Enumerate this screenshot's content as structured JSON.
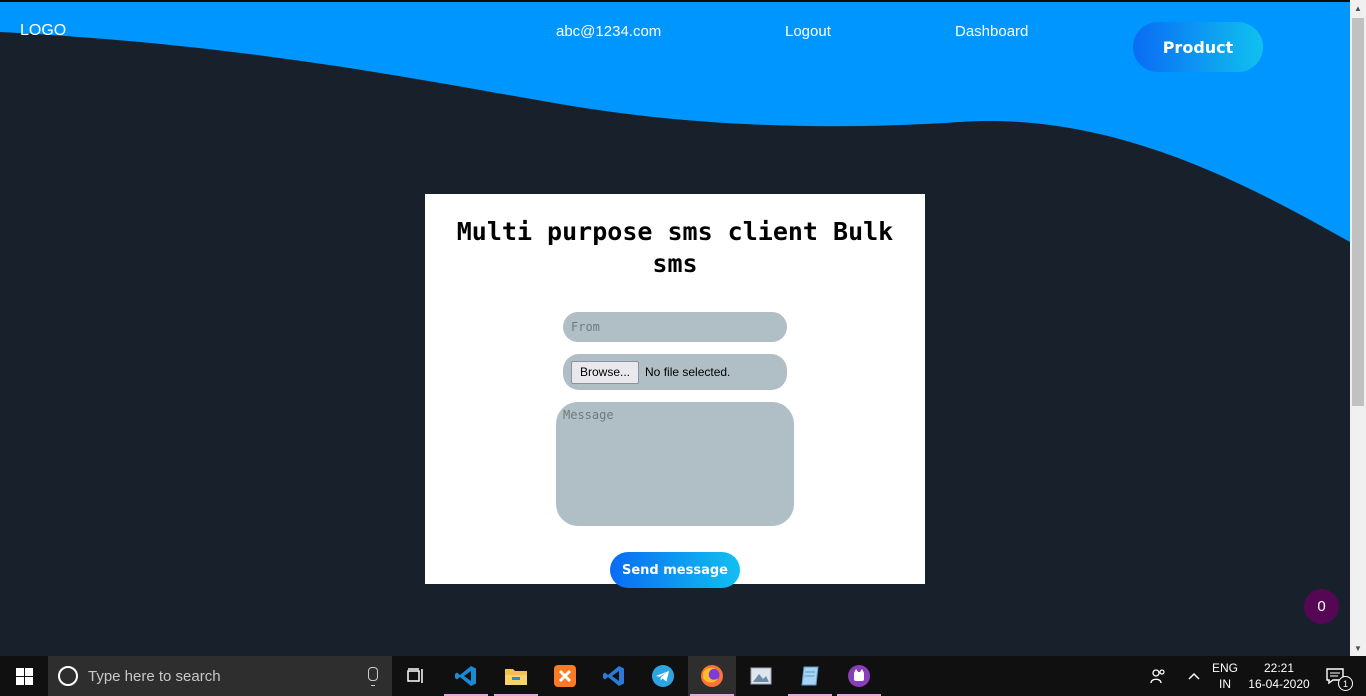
{
  "nav": {
    "logo": "LOGO",
    "email": "abc@1234.com",
    "logout": "Logout",
    "dashboard": "Dashboard",
    "product_button": "Product"
  },
  "form": {
    "title": "Multi purpose sms client Bulk sms",
    "from_placeholder": "From",
    "browse_label": "Browse...",
    "file_status": "No file selected.",
    "message_placeholder": "Message",
    "send_button": "Send message"
  },
  "badge": {
    "count": "0"
  },
  "taskbar": {
    "search_placeholder": "Type here to search",
    "language_line1": "ENG",
    "language_line2": "IN",
    "time": "22:21",
    "date": "16-04-2020",
    "notification_count": "1",
    "apps": [
      "task-view-icon",
      "vscode-icon",
      "file-explorer-icon",
      "xampp-icon",
      "visual-studio-icon",
      "telegram-icon",
      "firefox-icon",
      "photos-icon",
      "notepad-icon",
      "misc-app-icon"
    ]
  },
  "colors": {
    "accent_blue": "#0096ff",
    "background": "#17202b",
    "button_gradient_start": "#0a6cf5",
    "button_gradient_end": "#10c0ef",
    "field_gray": "#b0bec5",
    "badge": "#550754"
  }
}
